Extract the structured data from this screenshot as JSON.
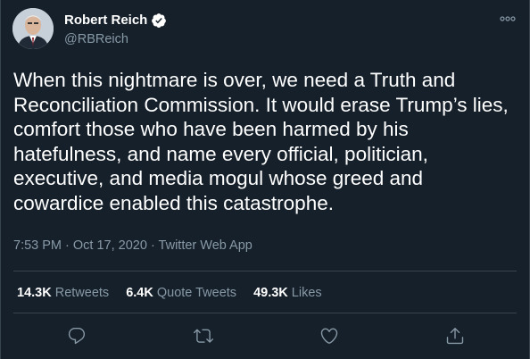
{
  "author": {
    "display_name": "Robert Reich",
    "handle": "@RBReich",
    "verified": true
  },
  "tweet": {
    "lines": [
      "When this nightmare is over, we need a Truth and",
      "Reconciliation Commission. It would erase Trump’s lies,",
      "comfort those who have been harmed by his",
      "hatefulness, and name every official, politician,",
      "executive, and media mogul whose greed and",
      "cowardice enabled this catastrophe."
    ],
    "meta": "7:53 PM · Oct 17, 2020 · Twitter Web App"
  },
  "stats": [
    {
      "count": "14.3K",
      "label": "Retweets"
    },
    {
      "count": "6.4K",
      "label": "Quote Tweets"
    },
    {
      "count": "49.3K",
      "label": "Likes"
    }
  ],
  "actions": [
    "reply-icon",
    "retweet-icon",
    "like-icon",
    "share-icon"
  ],
  "colors": {
    "background": "#15202b",
    "text_primary": "#ffffff",
    "text_secondary": "#8899a6",
    "divider": "#38444d",
    "verified_badge": "#ffffff"
  }
}
